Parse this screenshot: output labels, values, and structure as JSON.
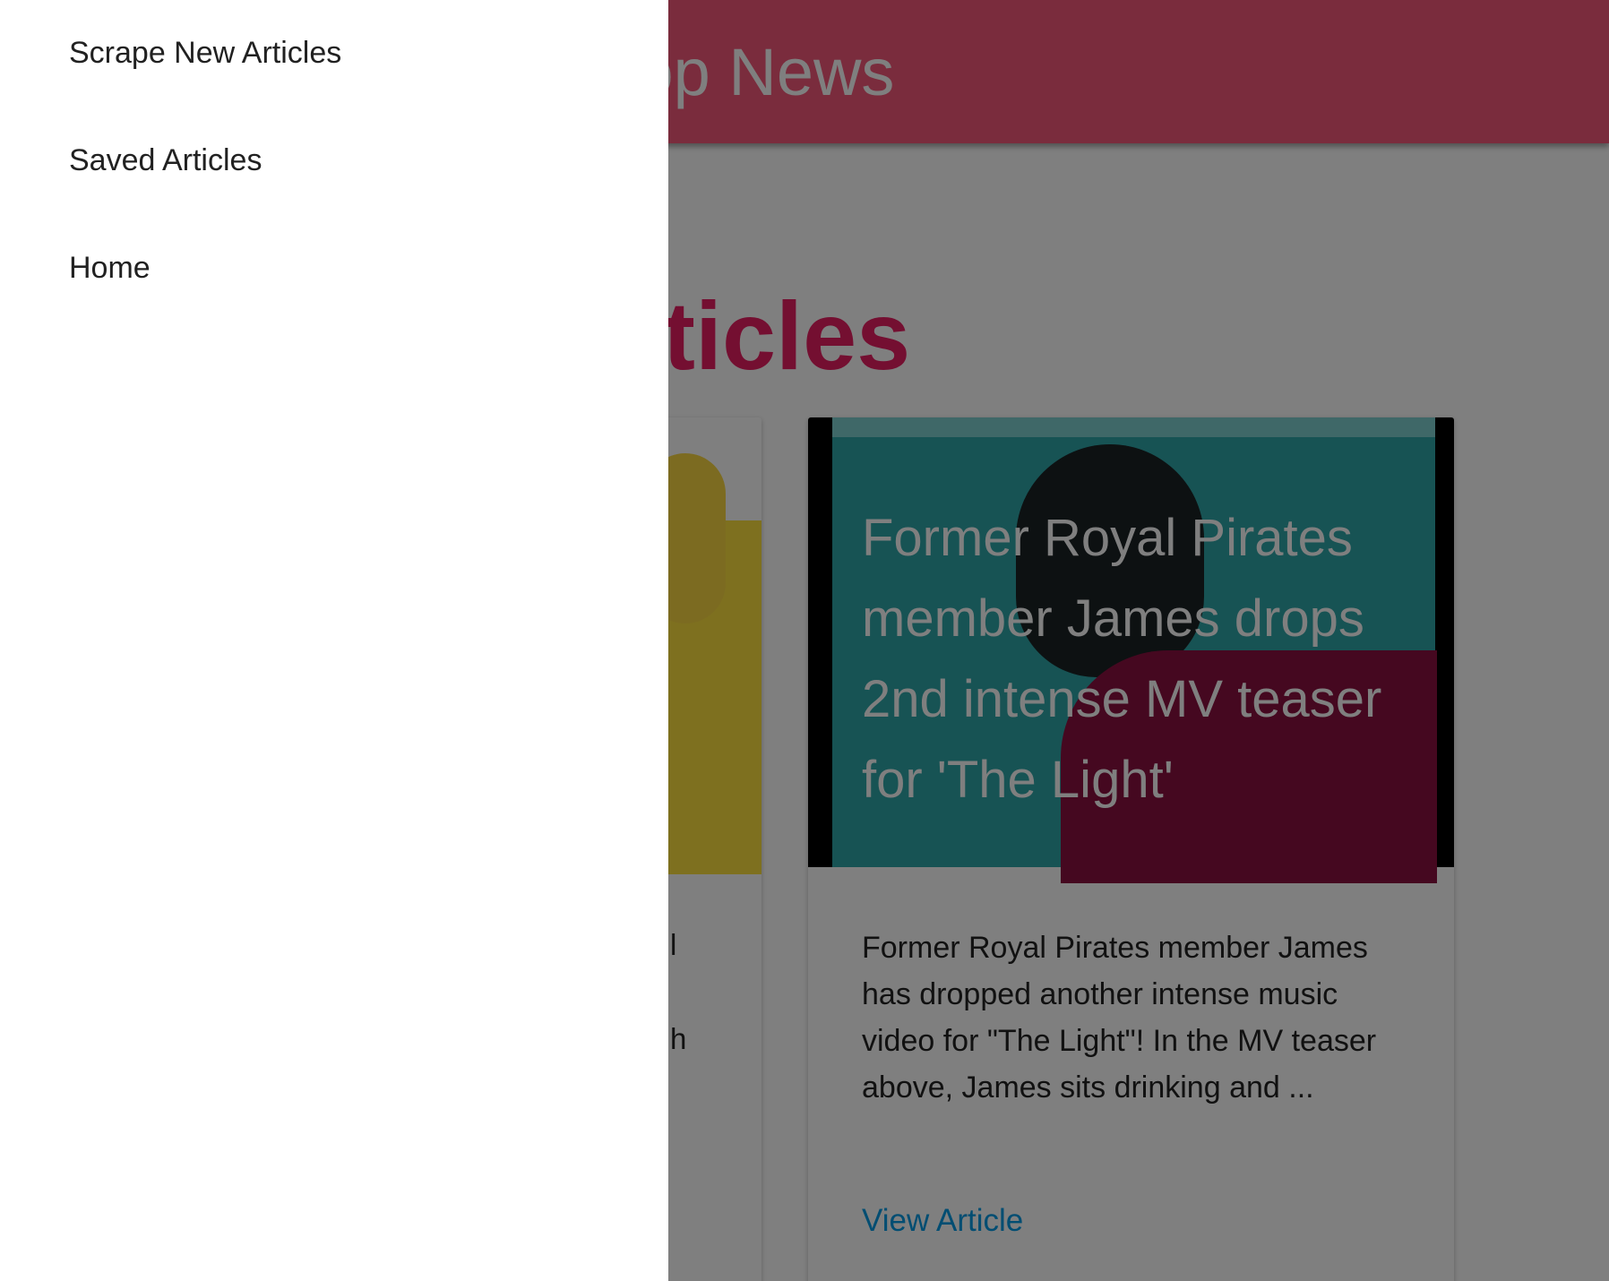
{
  "navbar": {
    "brand": "Kpop News"
  },
  "page": {
    "heading": "Articles"
  },
  "sidenav": {
    "items": [
      {
        "label": "Scrape New Articles"
      },
      {
        "label": "Saved Articles"
      },
      {
        "label": "Home"
      }
    ]
  },
  "cards": [
    {
      "fragments": [
        "l",
        "h"
      ]
    },
    {
      "title": "Former Royal Pirates member James drops 2nd intense MV teaser for 'The Light'",
      "summary": "Former Royal Pirates member James has dropped another intense music video for \"The Light\"! In the MV teaser above, James sits drinking and ...",
      "link_label": "View Article"
    }
  ],
  "colors": {
    "navbar": "#f5587b",
    "heading": "#e91e63",
    "link": "#039be5",
    "overlay": "rgba(0,0,0,0.5)"
  }
}
